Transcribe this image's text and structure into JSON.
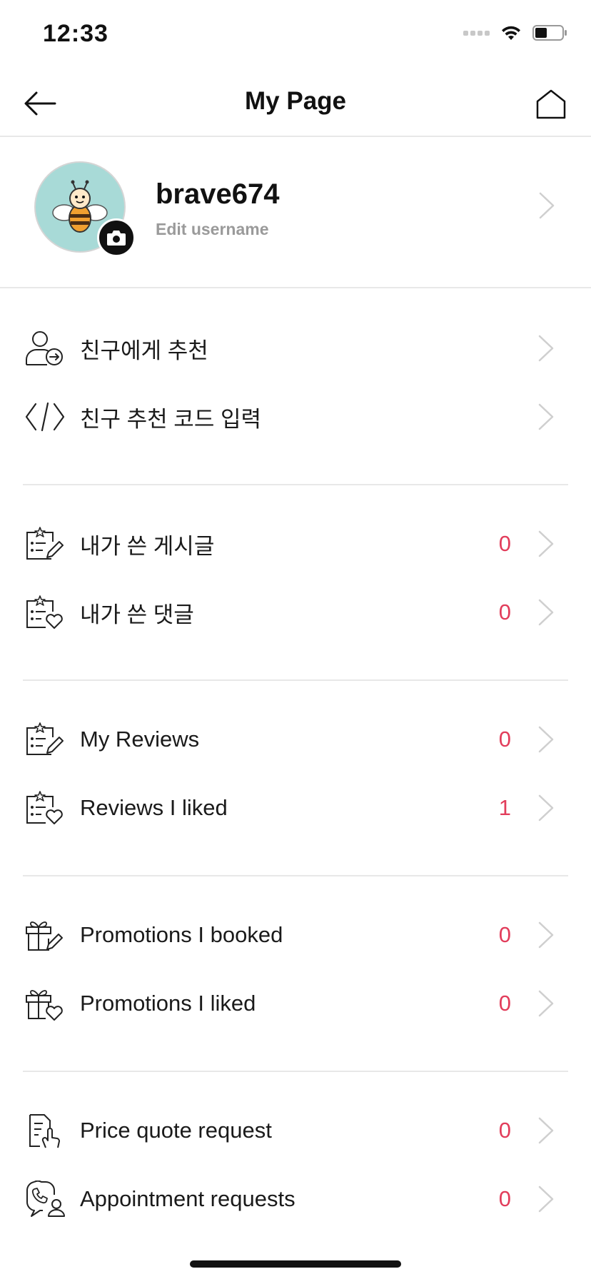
{
  "status_bar": {
    "time": "12:33"
  },
  "nav": {
    "title": "My Page"
  },
  "profile": {
    "username": "brave674",
    "edit_label": "Edit username"
  },
  "sections": [
    {
      "items": [
        {
          "label": "친구에게 추천",
          "icon": "user-share-icon",
          "count": null
        },
        {
          "label": "친구 추천 코드 입력",
          "icon": "code-icon",
          "count": null
        }
      ]
    },
    {
      "items": [
        {
          "label": "내가 쓴 게시글",
          "icon": "star-list-edit-icon",
          "count": "0"
        },
        {
          "label": "내가 쓴 댓글",
          "icon": "star-list-heart-icon",
          "count": "0"
        }
      ]
    },
    {
      "items": [
        {
          "label": "My Reviews",
          "icon": "star-list-edit-icon",
          "count": "0"
        },
        {
          "label": "Reviews I liked",
          "icon": "star-list-heart-icon",
          "count": "1"
        }
      ]
    },
    {
      "items": [
        {
          "label": "Promotions I booked",
          "icon": "gift-edit-icon",
          "count": "0"
        },
        {
          "label": "Promotions I liked",
          "icon": "gift-heart-icon",
          "count": "0"
        }
      ]
    },
    {
      "items": [
        {
          "label": "Price quote request",
          "icon": "document-touch-icon",
          "count": "0"
        },
        {
          "label": "Appointment requests",
          "icon": "phone-person-icon",
          "count": "0"
        }
      ]
    }
  ],
  "colors": {
    "accent": "#e23d5b",
    "avatar_bg": "#a8dad7",
    "divider": "#e8e8e8",
    "muted": "#9a9a9a"
  }
}
